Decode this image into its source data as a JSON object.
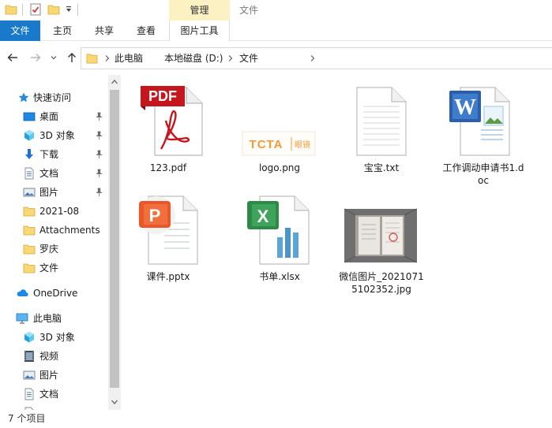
{
  "titlebar": {
    "context_tab": "管理",
    "title": "文件"
  },
  "ribbon": {
    "tabs": [
      "文件",
      "主页",
      "共享",
      "查看",
      "图片工具"
    ]
  },
  "address": {
    "breadcrumbs": [
      "此电脑",
      "本地磁盘 (D:)",
      "文件"
    ]
  },
  "nav_pane": {
    "items": [
      {
        "label": "快速访问",
        "icon": "star-icon",
        "pinned": false
      },
      {
        "label": "桌面",
        "icon": "desktop-icon",
        "pinned": true
      },
      {
        "label": "3D 对象",
        "icon": "cube-icon",
        "pinned": true
      },
      {
        "label": "下载",
        "icon": "download-icon",
        "pinned": true
      },
      {
        "label": "文档",
        "icon": "document-icon",
        "pinned": true
      },
      {
        "label": "图片",
        "icon": "picture-icon",
        "pinned": true
      },
      {
        "label": "2021-08",
        "icon": "folder-icon",
        "pinned": false
      },
      {
        "label": "Attachments",
        "icon": "folder-icon",
        "pinned": false
      },
      {
        "label": "罗庆",
        "icon": "folder-icon",
        "pinned": false
      },
      {
        "label": "文件",
        "icon": "folder-icon",
        "pinned": false
      },
      {
        "label": "OneDrive",
        "icon": "cloud-icon",
        "pinned": false
      },
      {
        "label": "此电脑",
        "icon": "computer-icon",
        "pinned": false
      },
      {
        "label": "3D 对象",
        "icon": "cube-icon",
        "pinned": false
      },
      {
        "label": "视频",
        "icon": "video-icon",
        "pinned": false
      },
      {
        "label": "图片",
        "icon": "picture-icon",
        "pinned": false
      },
      {
        "label": "文档",
        "icon": "document-icon",
        "pinned": false
      }
    ]
  },
  "files": [
    {
      "name": "123.pdf",
      "icon": "pdf-icon",
      "badge": "PDF"
    },
    {
      "name": "logo.png",
      "icon": "image-thumbnail-icon",
      "thumb_text": "TCTA",
      "thumb_sub": "眼镜"
    },
    {
      "name": "宝宝.txt",
      "icon": "text-file-icon"
    },
    {
      "name": "工作调动申请书1.doc",
      "icon": "word-icon",
      "badge": "W"
    },
    {
      "name": "课件.pptx",
      "icon": "powerpoint-icon",
      "badge": "P"
    },
    {
      "name": "书单.xlsx",
      "icon": "excel-icon",
      "badge": "X"
    },
    {
      "name": "微信图片_20210715102352.jpg",
      "icon": "photo-thumbnail-icon"
    }
  ],
  "status": {
    "text": "7 个项目"
  },
  "colors": {
    "accent": "#1979ca",
    "context_tab": "#fbf1c3",
    "folder": "#f8d775"
  }
}
